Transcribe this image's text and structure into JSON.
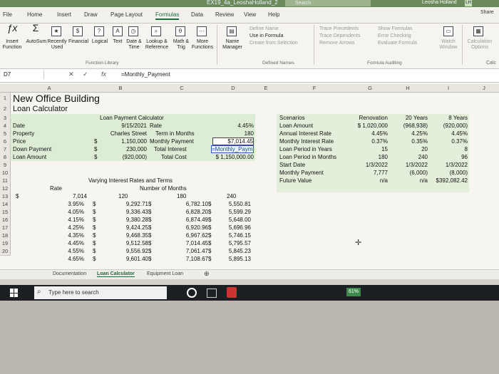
{
  "window": {
    "title": "EX19_4a_LeoshaHolland_2",
    "search_placeholder": "Search",
    "user_name": "Leosha Holland",
    "user_initials": "LH"
  },
  "menu": {
    "tabs": [
      "File",
      "Home",
      "Insert",
      "Draw",
      "Page Layout",
      "Formulas",
      "Data",
      "Review",
      "View",
      "Help"
    ],
    "active": "Formulas",
    "share": "Share"
  },
  "ribbon": {
    "insert_function": "Insert\nFunction",
    "autosum": "AutoSum",
    "recently_used": "Recently\nUsed",
    "financial": "Financial",
    "logical": "Logical",
    "text": "Text",
    "date_time": "Date &\nTime",
    "lookup_reference": "Lookup &\nReference",
    "math_trig": "Math &\nTrig",
    "more_functions": "More\nFunctions",
    "group_function_library": "Function Library",
    "name_manager": "Name\nManager",
    "define_name": "Define Name",
    "use_in_formula": "Use in Formula",
    "create_from_selection": "Create from Selection",
    "group_defined_names": "Defined Names",
    "trace_precedents": "Trace Precedents",
    "trace_dependents": "Trace Dependents",
    "remove_arrows": "Remove Arrows",
    "show_formulas": "Show Formulas",
    "error_checking": "Error Checking",
    "evaluate_formula": "Evaluate Formula",
    "group_formula_auditing": "Formula Auditing",
    "watch_window": "Watch\nWindow",
    "calculation_options": "Calculation\nOptions",
    "calc": "Calc"
  },
  "formula_bar": {
    "cell_ref": "D7",
    "fx": "fx",
    "formula": "=Monthly_Payment"
  },
  "columns": [
    "A",
    "B",
    "C",
    "D",
    "E",
    "F",
    "G",
    "H",
    "I",
    "J"
  ],
  "rows": [
    "1",
    "2",
    "3",
    "4",
    "5",
    "6",
    "7",
    "8",
    "9",
    "10",
    "11",
    "12",
    "13",
    "14",
    "15",
    "16",
    "17",
    "18",
    "19",
    "20"
  ],
  "sheet": {
    "title": "New Office Building",
    "subtitle": "Loan Calculator",
    "calc_header": "Loan Payment Calculator",
    "date_label": "Date",
    "date_value": "9/15/2021",
    "rate_label": "Rate",
    "rate_value": "4.45%",
    "property_label": "Property",
    "property_value": "Charles Street",
    "term_label": "Term in Months",
    "term_value": "180",
    "price_label": "Price",
    "price_cur": "$",
    "price_value": "1,150,000",
    "monthly_label": "Monthly Payment",
    "monthly_value": "$7,014.45",
    "down_label": "Down Payment",
    "down_cur": "$",
    "down_value": "230,000",
    "total_interest_label": "Total Interest",
    "total_interest_value": "=Monthly_Payment",
    "loan_label": "Loan Amount",
    "loan_cur": "$",
    "loan_value": "(920,000)",
    "total_cost_label": "Total Cost",
    "total_cost_value": "$ 1,150,000.00",
    "table_header": "Varying Interest Rates and Terms",
    "nm_header": "Number of Months",
    "rate_header": "Rate",
    "corner_value": "7,014",
    "terms": [
      "120",
      "180",
      "240"
    ],
    "rates": [
      "3.95%",
      "4.05%",
      "4.15%",
      "4.25%",
      "4.35%",
      "4.45%",
      "4.55%",
      "4.65%"
    ],
    "t120": [
      "9,292.71",
      "9,336.43",
      "9,380.28",
      "9,424.25",
      "9,468.35",
      "9,512.58",
      "9,556.92",
      "9,601.40"
    ],
    "t180": [
      "6,782.10",
      "6,828.20",
      "6,874.49",
      "6,920.96",
      "6,967.62",
      "7,014.45",
      "7,061.47",
      "7,108.67"
    ],
    "t240": [
      "5,550.81",
      "5,599.29",
      "5,648.00",
      "5,696.96",
      "5,746.15",
      "5,795.57",
      "5,845.23",
      "5,895.13"
    ]
  },
  "scenarios": {
    "title": "Scenarios",
    "labels": [
      "Loan Amount",
      "Annual Interest Rate",
      "Monthly Interest Rate",
      "Loan Period in Years",
      "Loan Period in Months",
      "Start Date",
      "Monthly Payment",
      "Future Value"
    ],
    "headers": [
      "Renovation",
      "20 Years",
      "8 Years"
    ],
    "renovation": [
      "$ 1,020,000",
      "4.45%",
      "0.37%",
      "15",
      "180",
      "1/3/2022",
      "7,777",
      "n/a"
    ],
    "twenty": [
      "(968,938)",
      "4.25%",
      "0.35%",
      "20",
      "240",
      "1/3/2022",
      "(6,000)",
      "n/a"
    ],
    "eight": [
      "(920,000)",
      "4.45%",
      "0.37%",
      "8",
      "96",
      "1/3/2022",
      "(8,000)",
      "$392,082.42"
    ]
  },
  "sheet_tabs": [
    "Documentation",
    "Loan Calculator",
    "Equipment Loan"
  ],
  "active_sheet": "Loan Calculator",
  "taskbar": {
    "search_placeholder": "Type here to search"
  },
  "colors": {
    "excel_green": "#1d6a3a",
    "highlight": "#c9e6c0",
    "taskbar": "#1c1f24"
  }
}
